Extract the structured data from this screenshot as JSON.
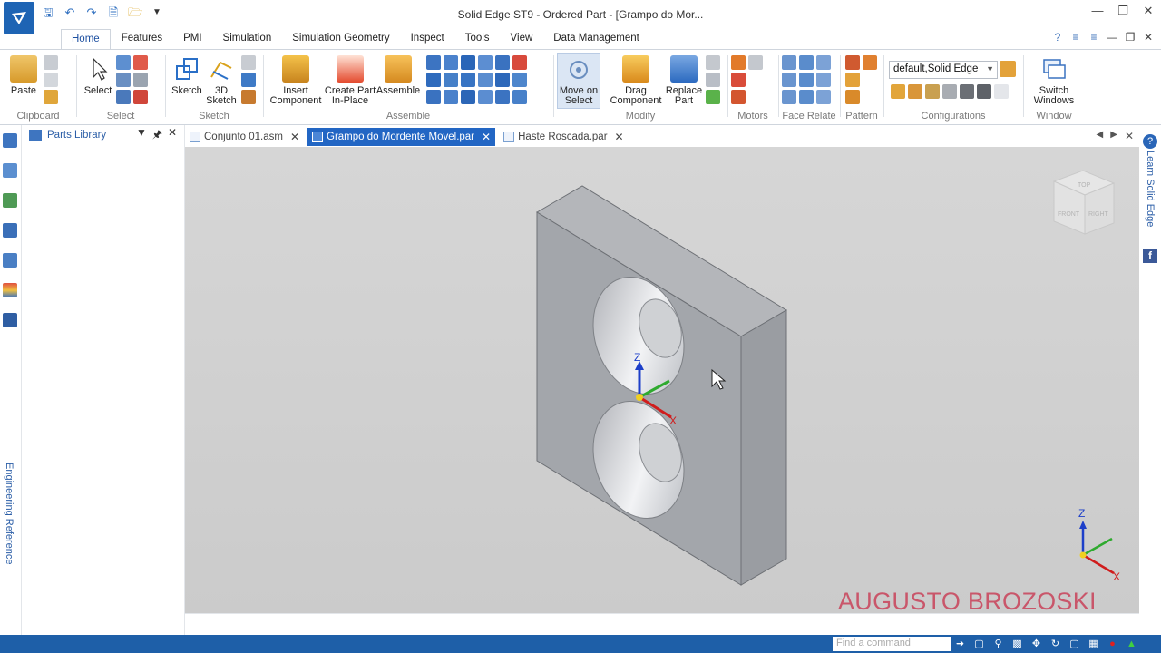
{
  "title": "Solid Edge ST9 - Ordered Part - [Grampo do Mor...",
  "tabs": [
    "Home",
    "Features",
    "PMI",
    "Simulation",
    "Simulation Geometry",
    "Inspect",
    "Tools",
    "View",
    "Data Management"
  ],
  "ribbon": {
    "paste": "Paste",
    "clipboard": "Clipboard",
    "select": "Select",
    "select_group": "Select",
    "sketch": "Sketch",
    "sketch3d_line1": "3D",
    "sketch3d_line2": "Sketch",
    "sketch_group": "Sketch",
    "insert_line1": "Insert",
    "insert_line2": "Component",
    "create_line1": "Create Part",
    "create_line2": "In-Place",
    "assemble": "Assemble",
    "assemble_group": "Assemble",
    "move_line1": "Move on",
    "move_line2": "Select",
    "drag_line1": "Drag",
    "drag_line2": "Component",
    "replace_line1": "Replace",
    "replace_line2": "Part",
    "modify_group": "Modify",
    "motors_group": "Motors",
    "face_relate_group": "Face Relate",
    "pattern_group": "Pattern",
    "configuration_value": "default,Solid Edge",
    "configurations_group": "Configurations",
    "switch_line1": "Switch",
    "switch_line2": "Windows",
    "window_group": "Window"
  },
  "pane": {
    "title": "Parts Library"
  },
  "left_strip_label": "Engineering Reference",
  "right_strip_label": "Learn Solid Edge",
  "doc_tabs": [
    {
      "label": "Conjunto 01.asm",
      "active": false
    },
    {
      "label": "Grampo do Mordente Movel.par",
      "active": true
    },
    {
      "label": "Haste Roscada.par",
      "active": false
    }
  ],
  "viewport": {
    "triad_z": "Z",
    "triad_x": "X",
    "view_triad_z": "Z",
    "view_triad_x": "X",
    "cube_top": "TOP",
    "cube_front": "FRONT",
    "cube_right": "RIGHT",
    "watermark": "AUGUSTO BROZOSKI"
  },
  "status": {
    "command_placeholder": "Find a command"
  },
  "colors": {
    "accent": "#2266c4",
    "statusbar": "#1e5fa8",
    "watermark": "#c9566a",
    "viewport_bg": "#d2d2d2"
  }
}
